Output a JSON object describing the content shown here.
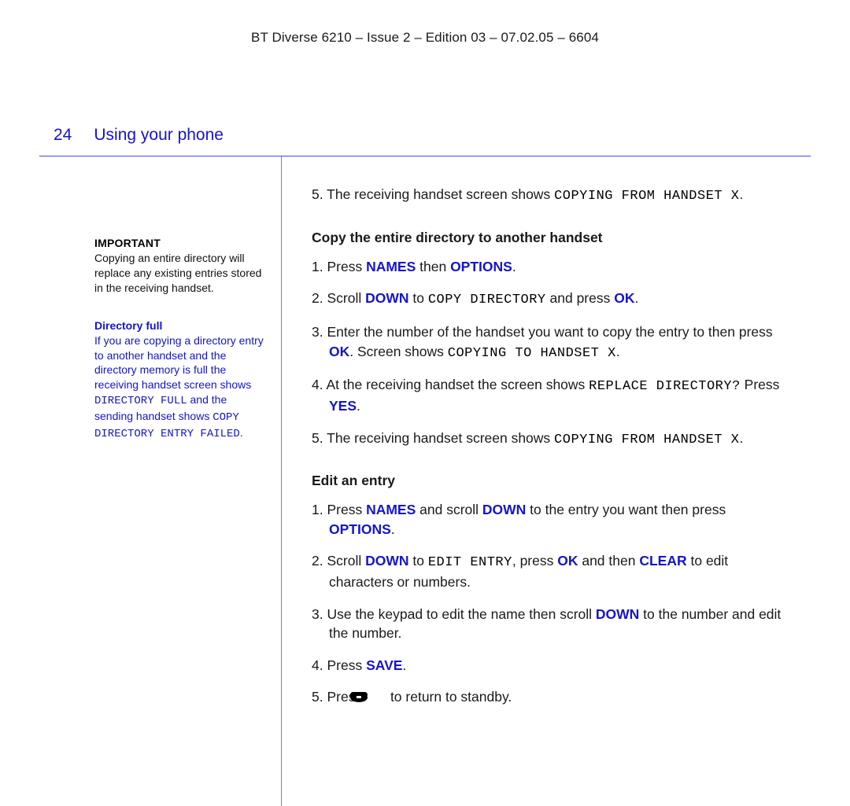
{
  "header": "BT Diverse 6210 – Issue 2 – Edition 03 – 07.02.05 – 6604",
  "page_number": "24",
  "page_title": "Using your phone",
  "sidebar": {
    "box1": {
      "heading": "IMPORTANT",
      "body": "Copying an entire directory will replace any existing entries stored in the receiving handset."
    },
    "box2": {
      "heading": "Directory full",
      "body_pre": "If you are copying a directory entry to another handset and the directory memory is full the receiving handset screen shows ",
      "mono1": "DIRECTORY FULL",
      "body_mid": " and the sending handset shows ",
      "mono2": "COPY DIRECTORY ENTRY FAILED",
      "body_post": "."
    }
  },
  "buttons": {
    "names": "NAMES",
    "options": "OPTIONS",
    "down": "DOWN",
    "ok": "OK",
    "yes": "YES",
    "clear": "CLEAR",
    "save": "SAVE"
  },
  "lcd": {
    "copying_from": "COPYING FROM HANDSET X",
    "copy_directory": "COPY DIRECTORY",
    "copying_to": "COPYING TO HANDSET X",
    "replace_directory": "REPLACE DIRECTORY?",
    "edit_entry": "EDIT ENTRY"
  },
  "main": {
    "top_step_num": "5.",
    "top_step_a": "The receiving handset screen shows ",
    "top_step_c": ".",
    "sub1": "Copy the entire directory to another handset",
    "s1_1a": "1. Press ",
    "s1_1b": " then ",
    "s1_1c": ".",
    "s1_2a": "2. Scroll ",
    "s1_2b": " to ",
    "s1_2c": " and press ",
    "s1_2d": ".",
    "s1_3a": "3. Enter the number of the handset you want to copy the entry to then press ",
    "s1_3b": ". Screen shows ",
    "s1_3c": ".",
    "s1_4a": "4. At the receiving handset the screen shows ",
    "s1_4b": " Press ",
    "s1_4c": ".",
    "s1_5a": "5. The receiving handset screen shows ",
    "s1_5b": ".",
    "sub2": "Edit an entry",
    "s2_1a": "1. Press ",
    "s2_1b": " and scroll ",
    "s2_1c": " to the entry you want then press ",
    "s2_1d": ".",
    "s2_2a": "2. Scroll ",
    "s2_2b": " to ",
    "s2_2c": ", press ",
    "s2_2d": " and then ",
    "s2_2e": " to edit characters or numbers.",
    "s2_3a": "3. Use the keypad to edit the name then scroll ",
    "s2_3b": " to the number and edit the number.",
    "s2_4a": "4. Press ",
    "s2_4b": ".",
    "s2_5a": "5. Press ",
    "s2_5b": " to return to standby."
  }
}
